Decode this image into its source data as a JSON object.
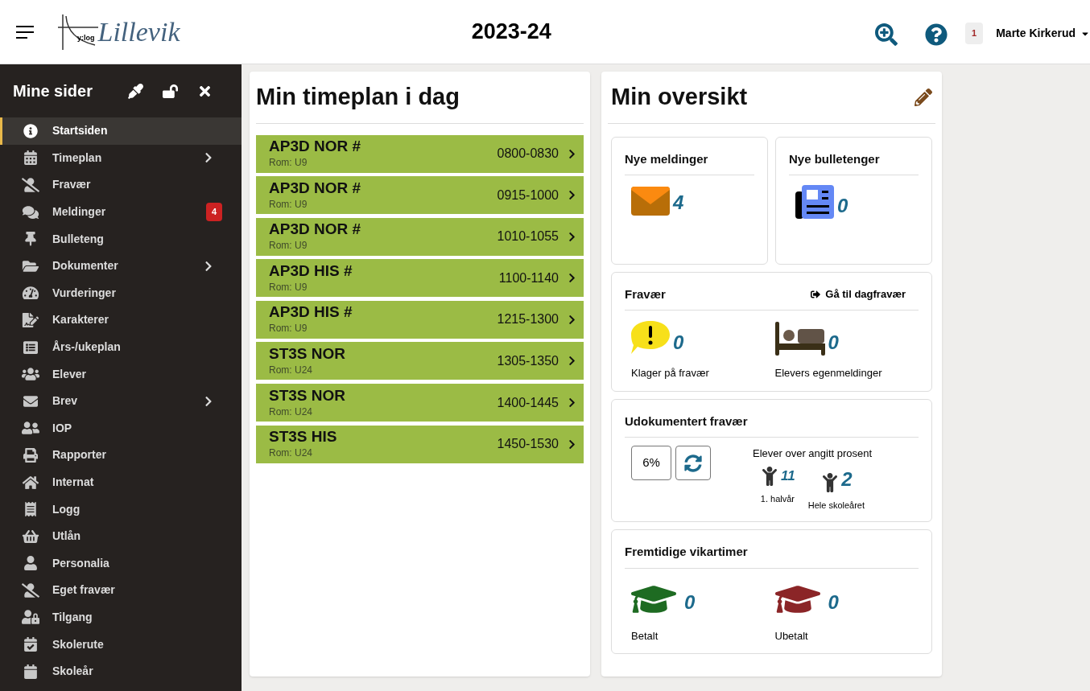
{
  "header": {
    "logo_text": "Lillevik",
    "logo_axis_label": "y:log",
    "title": "2023-24",
    "notification_count": "1",
    "user_name": "Marte Kirkerud"
  },
  "sidebar": {
    "title": "Mine sider",
    "items": [
      {
        "label": "Startsiden",
        "selected": true,
        "expandable": false
      },
      {
        "label": "Timeplan",
        "selected": false,
        "expandable": true
      },
      {
        "label": "Fravær",
        "selected": false,
        "expandable": false
      },
      {
        "label": "Meldinger",
        "selected": false,
        "expandable": false,
        "badge": "4"
      },
      {
        "label": "Bulleteng",
        "selected": false,
        "expandable": false
      },
      {
        "label": "Dokumenter",
        "selected": false,
        "expandable": true
      },
      {
        "label": "Vurderinger",
        "selected": false,
        "expandable": false
      },
      {
        "label": "Karakterer",
        "selected": false,
        "expandable": false
      },
      {
        "label": "Års-/ukeplan",
        "selected": false,
        "expandable": false
      },
      {
        "label": "Elever",
        "selected": false,
        "expandable": false
      },
      {
        "label": "Brev",
        "selected": false,
        "expandable": true
      },
      {
        "label": "IOP",
        "selected": false,
        "expandable": false
      },
      {
        "label": "Rapporter",
        "selected": false,
        "expandable": false
      },
      {
        "label": "Internat",
        "selected": false,
        "expandable": false
      },
      {
        "label": "Logg",
        "selected": false,
        "expandable": false
      },
      {
        "label": "Utlån",
        "selected": false,
        "expandable": false
      },
      {
        "label": "Personalia",
        "selected": false,
        "expandable": false
      },
      {
        "label": "Eget fravær",
        "selected": false,
        "expandable": false
      },
      {
        "label": "Tilgang",
        "selected": false,
        "expandable": false
      },
      {
        "label": "Skolerute",
        "selected": false,
        "expandable": false
      },
      {
        "label": "Skoleår",
        "selected": false,
        "expandable": false
      }
    ]
  },
  "schedule": {
    "title": "Min timeplan i dag",
    "lessons": [
      {
        "course": "AP3D NOR #",
        "room": "Rom: U9",
        "time": "0800-0830"
      },
      {
        "course": "AP3D NOR #",
        "room": "Rom: U9",
        "time": "0915-1000"
      },
      {
        "course": "AP3D NOR #",
        "room": "Rom: U9",
        "time": "1010-1055"
      },
      {
        "course": "AP3D HIS #",
        "room": "Rom: U9",
        "time": "1100-1140"
      },
      {
        "course": "AP3D HIS #",
        "room": "Rom: U9",
        "time": "1215-1300"
      },
      {
        "course": "ST3S NOR",
        "room": "Rom: U24",
        "time": "1305-1350"
      },
      {
        "course": "ST3S NOR",
        "room": "Rom: U24",
        "time": "1400-1445"
      },
      {
        "course": "ST3S HIS",
        "room": "Rom: U24",
        "time": "1450-1530"
      }
    ]
  },
  "overview": {
    "title": "Min oversikt",
    "messages": {
      "title": "Nye meldinger",
      "count": "4"
    },
    "bulletins": {
      "title": "Nye bulletenger",
      "count": "0"
    },
    "absence": {
      "title": "Fravær",
      "link": "Gå til dagfravær",
      "items": [
        {
          "count": "0",
          "label": "Klager på fravær"
        },
        {
          "count": "0",
          "label": "Elevers egenmeldinger"
        }
      ]
    },
    "undocumented": {
      "title": "Udokumentert fravær",
      "percent": "6%",
      "caption": "Elever over angitt prosent",
      "stats": [
        {
          "count": "11",
          "label": "1. halvår"
        },
        {
          "count": "2",
          "label": "Hele skoleåret"
        }
      ]
    },
    "substitutes": {
      "title": "Fremtidige vikartimer",
      "items": [
        {
          "count": "0",
          "label": "Betalt",
          "color": "#1e6b22"
        },
        {
          "count": "0",
          "label": "Ubetalt",
          "color": "#8b2527"
        }
      ]
    }
  }
}
